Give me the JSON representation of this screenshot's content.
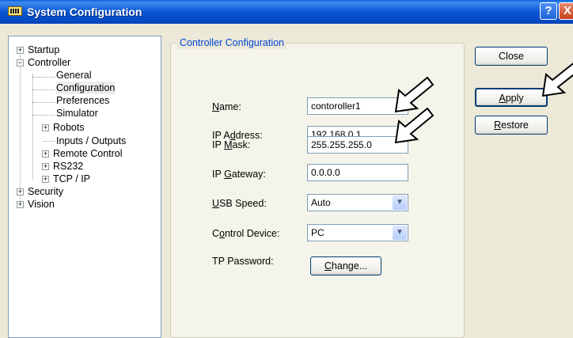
{
  "window": {
    "title": "System Configuration",
    "help_glyph": "?",
    "close_glyph": "X"
  },
  "tree": {
    "startup": "Startup",
    "controller": "Controller",
    "general": "General",
    "configuration": "Configuration",
    "preferences": "Preferences",
    "simulator": "Simulator",
    "robots": "Robots",
    "inputs_outputs": "Inputs / Outputs",
    "remote_control": "Remote Control",
    "rs232": "RS232",
    "tcp_ip": "TCP / IP",
    "security": "Security",
    "vision": "Vision",
    "plus": "+",
    "minus": "−"
  },
  "panel": {
    "title": "Controller Configuration",
    "name_label_u": "N",
    "name_label_rest": "ame:",
    "name_value": "contoroller1",
    "ip_label_pre": "IP A",
    "ip_label_u": "d",
    "ip_label_rest": "dress:",
    "ip_value": "192.168.0.1",
    "mask_label_pre": "IP ",
    "mask_label_u": "M",
    "mask_label_rest": "ask:",
    "mask_value": "255.255.255.0",
    "gw_label_pre": "IP ",
    "gw_label_u": "G",
    "gw_label_rest": "ateway:",
    "gw_value": "0.0.0.0",
    "usb_label_u": "U",
    "usb_label_rest": "SB Speed:",
    "usb_value": "Auto",
    "cd_label_pre": "C",
    "cd_label_u": "o",
    "cd_label_rest": "ntrol Device:",
    "cd_value": "PC",
    "tp_label": "TP Password:",
    "change_u": "C",
    "change_rest": "hange..."
  },
  "buttons": {
    "close": "Close",
    "apply_u": "A",
    "apply_rest": "pply",
    "restore_u": "R",
    "restore_rest": "estore"
  },
  "icons": {
    "dropdown": "chevron-down-icon",
    "annotation": "pointer-arrow-icon"
  }
}
